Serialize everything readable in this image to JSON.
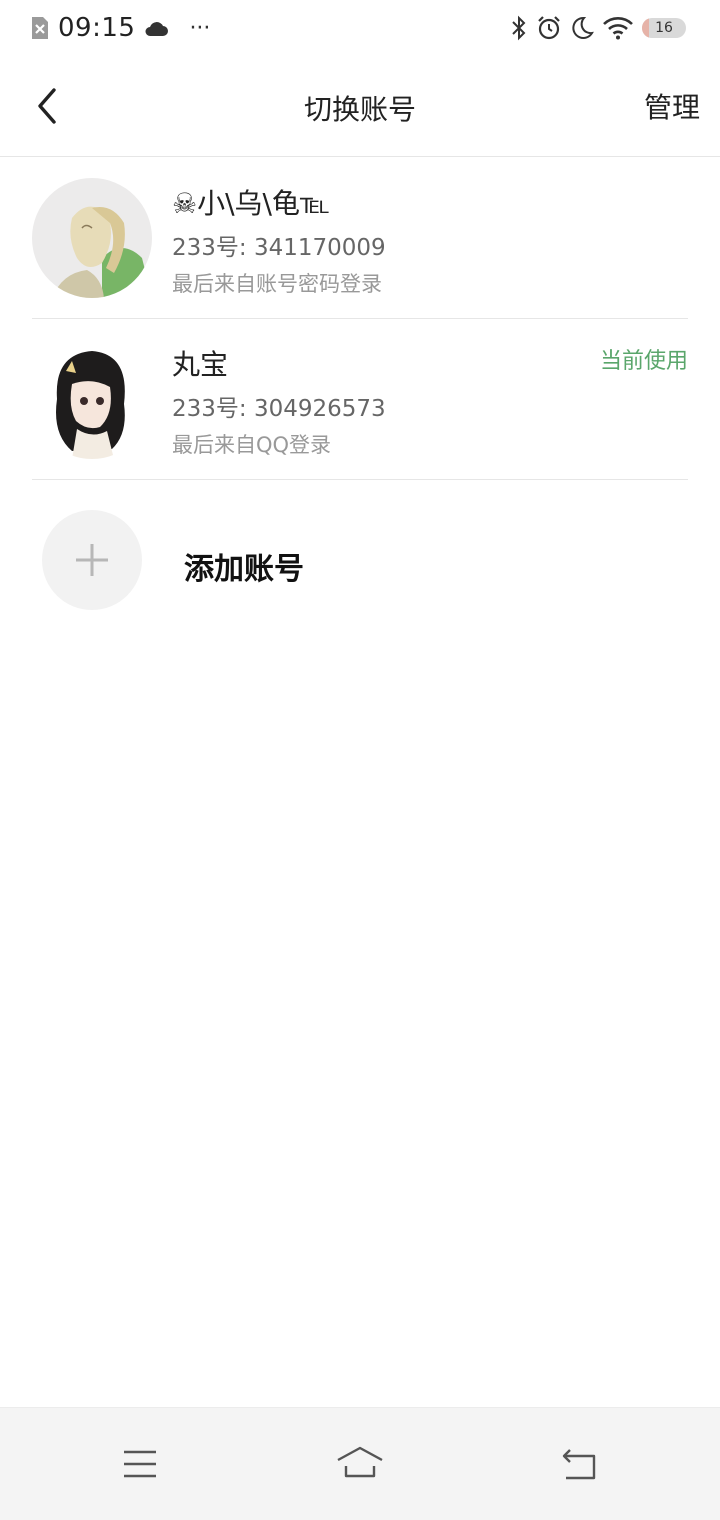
{
  "status_bar": {
    "time": "09:15",
    "more": "···",
    "battery_level": "16",
    "battery_fraction": 0.16
  },
  "header": {
    "title": "切换账号",
    "manage_label": "管理"
  },
  "accounts": [
    {
      "name": "☠小\\乌\\龟℡",
      "id_line": "233号: 341170009",
      "source": "最后来自账号密码登录",
      "current": false
    },
    {
      "name": "丸宝",
      "id_line": "233号: 304926573",
      "source": "最后来自QQ登录",
      "current": true,
      "current_label": "当前使用"
    }
  ],
  "add_account": {
    "label": "添加账号"
  },
  "icons": {
    "back": "chevron-left-icon",
    "menu": "menu-icon",
    "home": "home-icon",
    "return": "back-arrow-icon",
    "add": "plus-icon"
  },
  "colors": {
    "accent_green": "#5aa66b",
    "divider": "#e6e6e6",
    "nav_bg": "#f4f4f4"
  }
}
